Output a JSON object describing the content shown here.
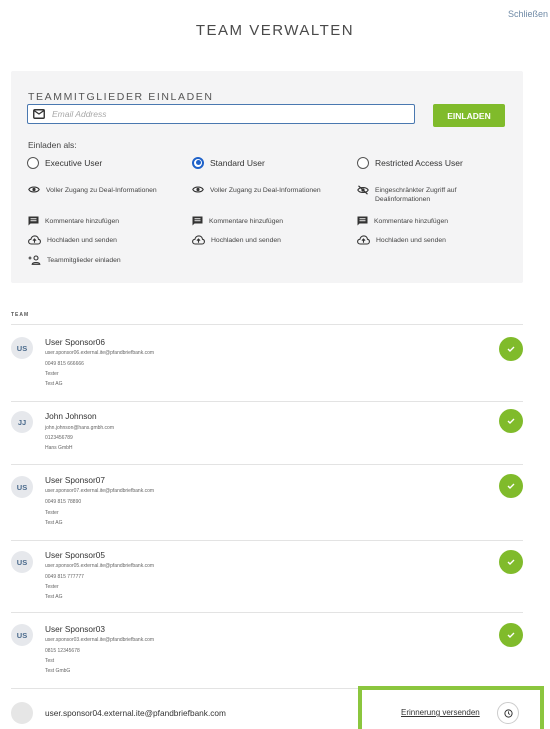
{
  "header": {
    "close_label": "Schließen",
    "title": "TEAM VERWALTEN"
  },
  "invite": {
    "heading": "TEAMMITGLIEDER EINLADEN",
    "email_placeholder": "Email Address",
    "invite_button": "EINLADEN",
    "invite_as_label": "Einladen als:",
    "roles": [
      {
        "label": "Executive User",
        "selected": false,
        "features": [
          {
            "icon": "eye-icon",
            "text": "Voller Zugang zu Deal-Informationen"
          },
          {
            "icon": "comment-icon",
            "text": "Kommentare hinzufügen"
          },
          {
            "icon": "cloud-upload-icon",
            "text": "Hochladen und senden"
          },
          {
            "icon": "add-user-icon",
            "text": "Teammitglieder einladen"
          }
        ]
      },
      {
        "label": "Standard User",
        "selected": true,
        "features": [
          {
            "icon": "eye-icon",
            "text": "Voller Zugang zu Deal-Informationen"
          },
          {
            "icon": "comment-icon",
            "text": "Kommentare hinzufügen"
          },
          {
            "icon": "cloud-upload-icon",
            "text": "Hochladen und senden"
          }
        ]
      },
      {
        "label": "Restricted Access User",
        "selected": false,
        "features": [
          {
            "icon": "eye-off-icon",
            "text": "Eingeschränkter Zugriff auf Dealinformationen"
          },
          {
            "icon": "comment-icon",
            "text": "Kommentare hinzufügen"
          },
          {
            "icon": "cloud-upload-icon",
            "text": "Hochladen und senden"
          }
        ]
      }
    ]
  },
  "team": {
    "label": "TEAM",
    "members": [
      {
        "initials": "US",
        "name": "User Sponsor06",
        "email": "user.sponsor06.external.ite@pfandbriefbank.com",
        "phone": "0049 815 666666",
        "role": "Tester",
        "company": "Test AG"
      },
      {
        "initials": "JJ",
        "name": "John Johnson",
        "email": "john.johnson@hans.gmbh.com",
        "phone": "0123456789",
        "role": "",
        "company": "Hans GmbH"
      },
      {
        "initials": "US",
        "name": "User Sponsor07",
        "email": "user.sponsor07.external.ite@pfandbriefbank.com",
        "phone": "0049 815 78890",
        "role": "Tester",
        "company": "Test AG"
      },
      {
        "initials": "US",
        "name": "User Sponsor05",
        "email": "user.sponsor05.external.ite@pfandbriefbank.com",
        "phone": "0049 815 777777",
        "role": "Tester",
        "company": "Test AG"
      },
      {
        "initials": "US",
        "name": "User Sponsor03",
        "email": "user.sponsor03.external.ite@pfandbriefbank.com",
        "phone": "0815 12345678",
        "role": "Test",
        "company": "Test GmbG"
      }
    ],
    "pending": {
      "email": "user.sponsor04.external.ite@pfandbriefbank.com",
      "reminder_label": "Erinnerung versenden"
    }
  },
  "colors": {
    "accent_green": "#80bb2b",
    "highlight_green": "#8bc63e",
    "radio_blue": "#1f62c9",
    "input_border": "#4a78b0"
  }
}
